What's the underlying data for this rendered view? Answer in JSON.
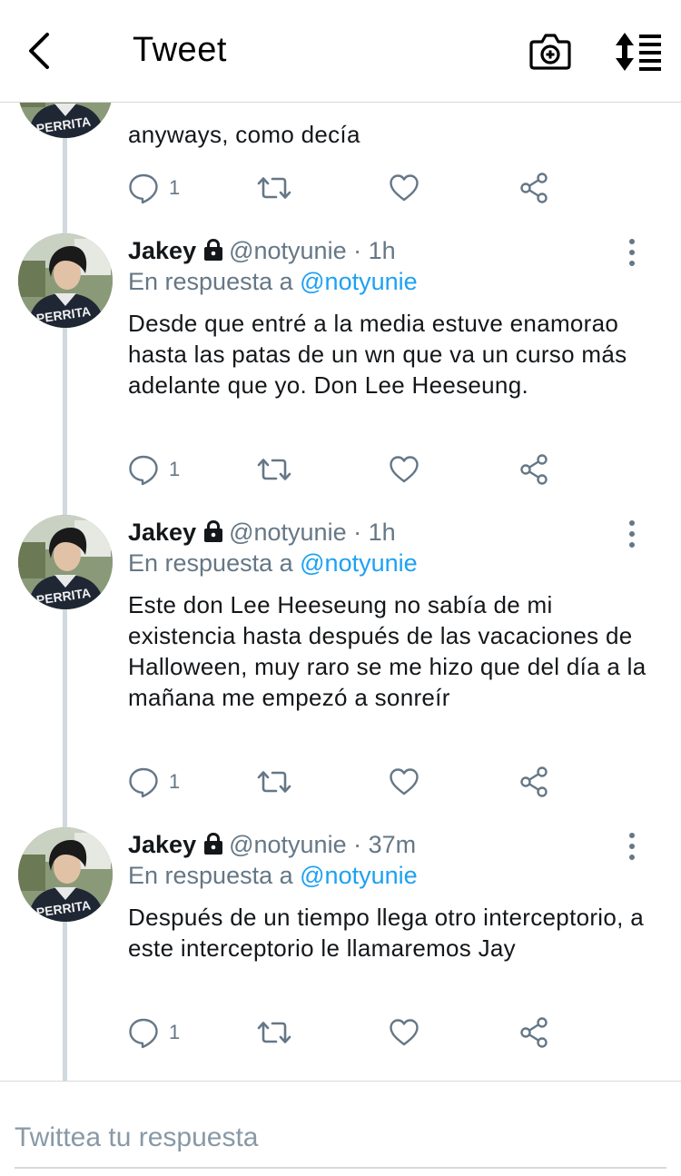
{
  "header": {
    "title": "Tweet"
  },
  "partial_tweet": {
    "text": "anyways, como decía",
    "reply_count": "1"
  },
  "tweets": [
    {
      "name": "Jakey",
      "handle": "@notyunie",
      "sep": "·",
      "time": "1h",
      "reply_prefix": "En respuesta a",
      "reply_mention": "@notyunie",
      "text": "Desde que entré a la media estuve enamorao hasta las patas de un wn que va un curso más adelante que yo. Don Lee Heeseung.",
      "reply_count": "1"
    },
    {
      "name": "Jakey",
      "handle": "@notyunie",
      "sep": "·",
      "time": "1h",
      "reply_prefix": "En respuesta a",
      "reply_mention": "@notyunie",
      "text": "Este don Lee Heeseung no sabía de mi existencia hasta después de las vacaciones de Halloween, muy raro se me hizo que del día a la mañana me empezó a sonreír",
      "reply_count": "1"
    },
    {
      "name": "Jakey",
      "handle": "@notyunie",
      "sep": "·",
      "time": "37m",
      "reply_prefix": "En respuesta a",
      "reply_mention": "@notyunie",
      "text": "Después de un tiempo llega otro interceptorio, a este interceptorio le llamaremos Jay",
      "reply_count": "1"
    }
  ],
  "composer": {
    "placeholder": "Twittea tu respuesta"
  },
  "icons": {
    "back": "chevron-left-icon",
    "camera": "camera-plus-icon",
    "sort": "sort-icon",
    "lock": "lock-icon",
    "more": "more-vertical-icon",
    "reply": "reply-icon",
    "retweet": "retweet-icon",
    "like": "heart-icon",
    "share": "share-icon"
  },
  "colors": {
    "accent": "#1da1f2",
    "secondary_text": "#657786",
    "thread_line": "#cfd9de"
  }
}
